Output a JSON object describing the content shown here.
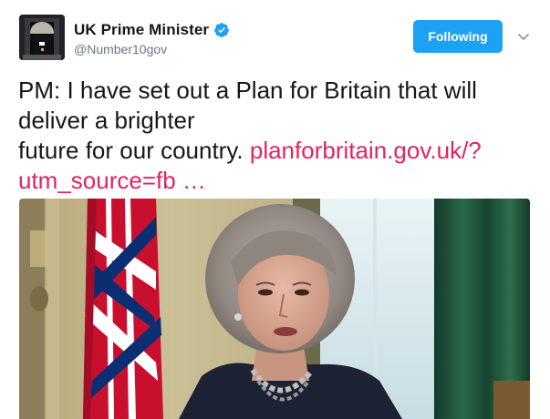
{
  "author": {
    "display_name": "UK Prime Minister",
    "handle": "@Number10gov",
    "verified": true,
    "avatar_icon": "number-10-door-avatar"
  },
  "actions": {
    "follow_label": "Following",
    "caret_icon": "chevron-down-icon"
  },
  "tweet": {
    "text_lines": [
      "PM: I have set out a Plan for Britain that will",
      "deliver a brighter",
      "future for our country. "
    ],
    "link_part1": "planforbritain.gov.uk/?",
    "link_part2": "utm_source=fb  …"
  },
  "media": {
    "description_icon": "video-still-image"
  },
  "colors": {
    "accent": "#1da1f2",
    "link": "#e0245e",
    "text": "#14171a",
    "muted": "#657786"
  }
}
